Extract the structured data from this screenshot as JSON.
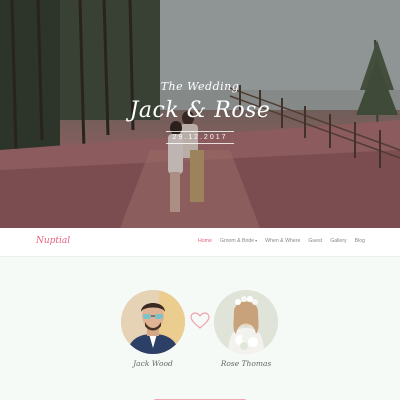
{
  "hero": {
    "subtitle": "The Wedding",
    "title": "Jack & Rose",
    "date": "29.12.2017"
  },
  "nav": {
    "logo": "Nuptial",
    "items": [
      {
        "label": "Home",
        "active": true,
        "dropdown": false
      },
      {
        "label": "Groom & Bride",
        "active": false,
        "dropdown": true
      },
      {
        "label": "When & Where",
        "active": false,
        "dropdown": false
      },
      {
        "label": "Guest",
        "active": false,
        "dropdown": false
      },
      {
        "label": "Gallery",
        "active": false,
        "dropdown": false
      },
      {
        "label": "Blog",
        "active": false,
        "dropdown": false
      }
    ]
  },
  "couple": {
    "groom_name": "Jack Wood",
    "bride_name": "Rose Thomas"
  },
  "colors": {
    "accent": "#e8607a",
    "section_bg": "#f5faf7"
  },
  "icons": {
    "heart": "heart-outline-icon",
    "caret": "chevron-down-icon"
  }
}
